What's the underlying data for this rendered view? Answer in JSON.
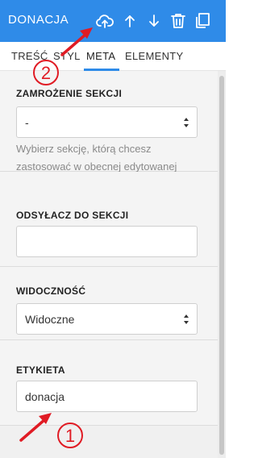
{
  "header": {
    "title": "DONACJA",
    "icons": [
      "cloud-upload-icon",
      "arrow-up-icon",
      "arrow-down-icon",
      "trash-icon",
      "duplicate-icon"
    ],
    "color": "#2f8be8"
  },
  "tabs": [
    {
      "label": "TREŚĆ"
    },
    {
      "label": "STYL"
    },
    {
      "label": "META",
      "active": true
    },
    {
      "label": "ELEMENTY"
    }
  ],
  "sections": {
    "freeze": {
      "label": "ZAMROŻENIE SEKCJI",
      "value": "-",
      "help": "Wybierz sekcję, którą chcesz zastosować w obecnej edytowanej"
    },
    "anchor": {
      "label": "ODSYŁACZ DO SEKCJI",
      "value": ""
    },
    "visibility": {
      "label": "WIDOCZNOŚĆ",
      "value": "Widoczne"
    },
    "tag": {
      "label": "ETYKIETA",
      "value": "donacja"
    }
  },
  "annotations": {
    "marker_1": "1",
    "marker_2": "2",
    "color": "#e01b24"
  }
}
